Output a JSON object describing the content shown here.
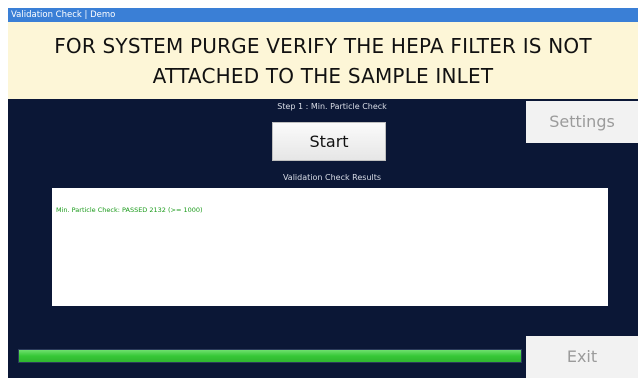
{
  "window": {
    "title": "Validation Check | Demo"
  },
  "warning": {
    "line1": "FOR SYSTEM PURGE VERIFY THE HEPA FILTER IS NOT",
    "line2": "ATTACHED TO THE SAMPLE INLET"
  },
  "step": {
    "label": "Step 1 : Min. Particle Check",
    "start_label": "Start"
  },
  "settings": {
    "label": "Settings"
  },
  "results": {
    "label": "Validation Check Results",
    "lines": [
      "Min. Particle Check: PASSED 2132 (>= 1000)"
    ]
  },
  "progress": {
    "percent": 100,
    "color": "#37c837"
  },
  "exit": {
    "label": "Exit"
  },
  "colors": {
    "background": "#0b1736",
    "titlebar": "#3a7fd6",
    "warning_bg": "#fdf6d7",
    "result_text": "#1a9a1a"
  }
}
